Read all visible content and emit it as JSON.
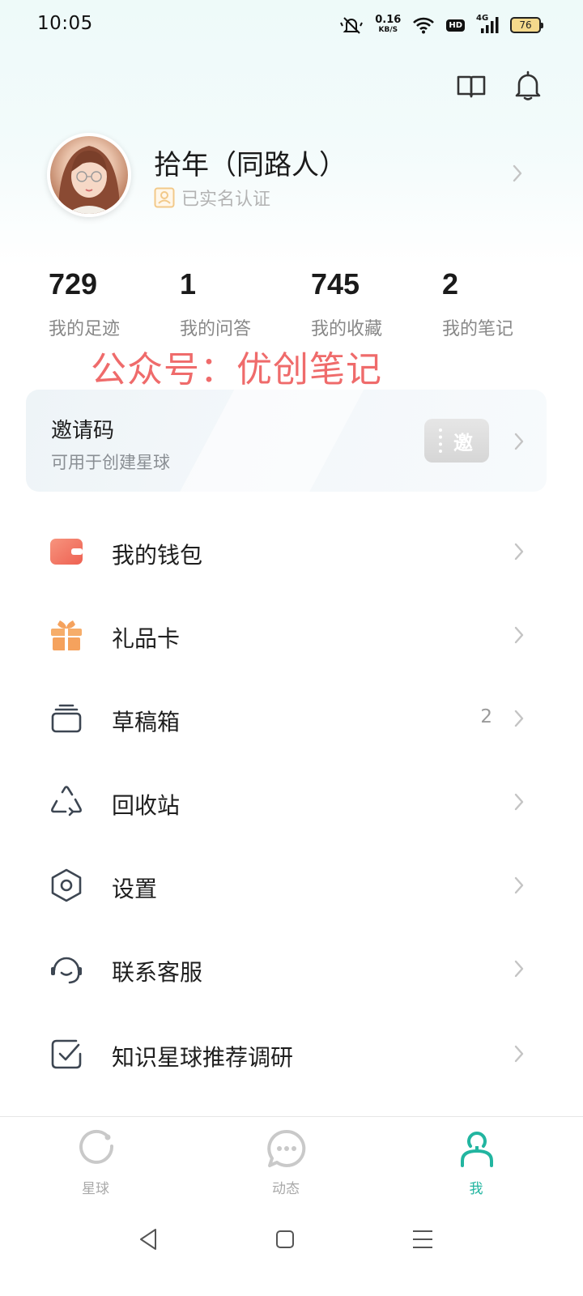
{
  "status_bar": {
    "time": "10:05",
    "net_speed_value": "0.16",
    "net_speed_unit": "KB/S",
    "hd": "HD",
    "network": "4G",
    "battery": "76"
  },
  "header": {
    "book_icon": "book-icon",
    "bell_icon": "bell-icon"
  },
  "profile": {
    "name": "拾年（同路人）",
    "verified_text": "已实名认证"
  },
  "stats": [
    {
      "value": "729",
      "label": "我的足迹"
    },
    {
      "value": "1",
      "label": "我的问答"
    },
    {
      "value": "745",
      "label": "我的收藏"
    },
    {
      "value": "2",
      "label": "我的笔记"
    }
  ],
  "watermark": "公众号：优创笔记",
  "invite": {
    "title": "邀请码",
    "subtitle": "可用于创建星球",
    "ticket_text": "邀"
  },
  "menu": [
    {
      "label": "我的钱包",
      "icon": "wallet-icon",
      "badge": ""
    },
    {
      "label": "礼品卡",
      "icon": "gift-icon",
      "badge": ""
    },
    {
      "label": "草稿箱",
      "icon": "drafts-icon",
      "badge": "2"
    },
    {
      "label": "回收站",
      "icon": "recycle-icon",
      "badge": ""
    },
    {
      "label": "设置",
      "icon": "settings-icon",
      "badge": ""
    },
    {
      "label": "联系客服",
      "icon": "headset-icon",
      "badge": ""
    },
    {
      "label": "知识星球推荐调研",
      "icon": "checkbox-icon",
      "badge": ""
    }
  ],
  "tabs": [
    {
      "label": "星球",
      "active": false
    },
    {
      "label": "动态",
      "active": false
    },
    {
      "label": "我",
      "active": true
    }
  ],
  "colors": {
    "accent": "#22b5a0",
    "watermark": "#ef6b6b",
    "wallet": "#f0735f",
    "gift": "#f5a25d",
    "icon_dark": "#3d4652"
  }
}
